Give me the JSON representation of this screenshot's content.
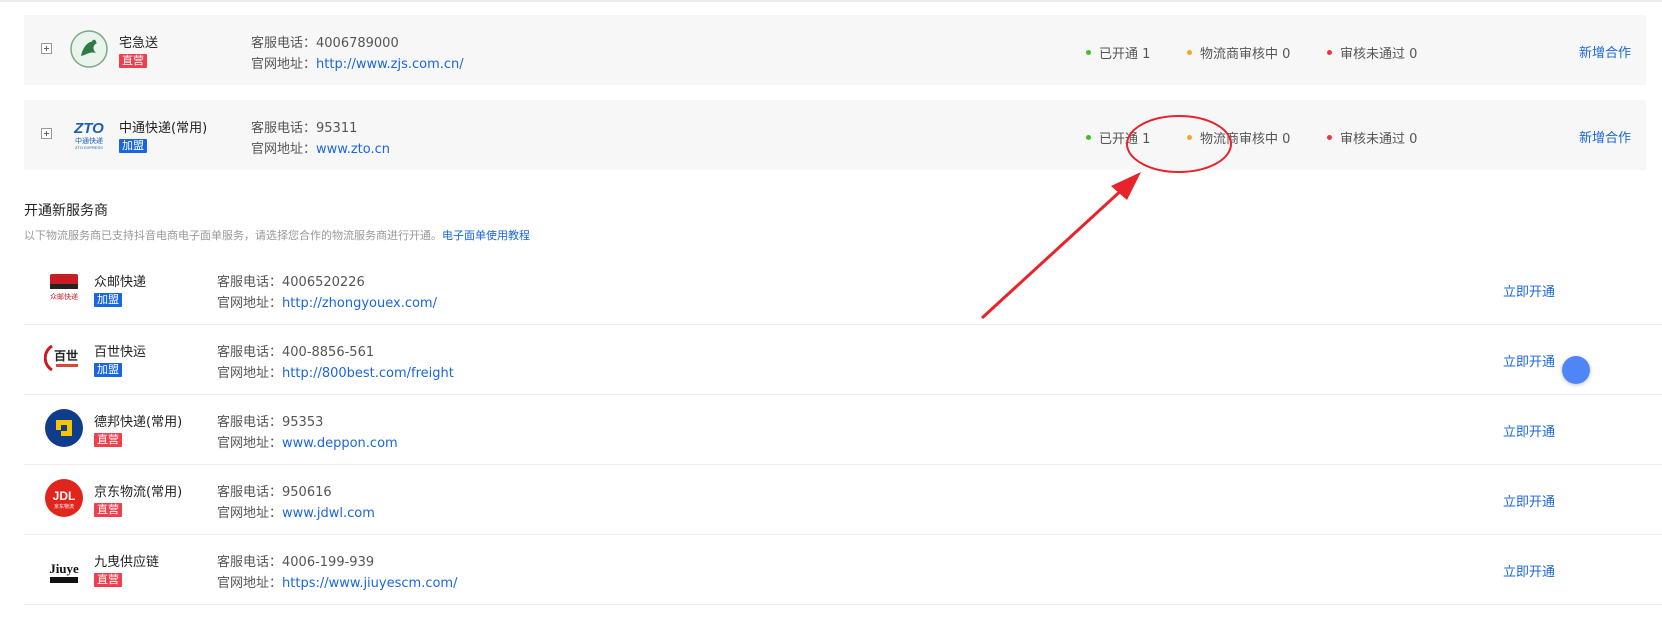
{
  "labels": {
    "phone_prefix": "客服电话：",
    "site_prefix": "官网地址："
  },
  "cooperating": [
    {
      "name": "宅急送",
      "tag": "直营",
      "phone": "4006789000",
      "site": "http://www.zjs.com.cn/",
      "stats": {
        "opened": "已开通 1",
        "reviewing": "物流商审核中 0",
        "rejected": "审核未通过 0"
      },
      "action": "新增合作"
    },
    {
      "name": "中通快递(常用)",
      "tag": "加盟",
      "logo_text": "ZTO",
      "logo_sub": "中通快递",
      "logo_sub2": "ZTO EXPRESS",
      "phone": "95311",
      "site": "www.zto.cn",
      "stats": {
        "opened": "已开通 1",
        "reviewing": "物流商审核中 0",
        "rejected": "审核未通过 0"
      },
      "action": "新增合作"
    }
  ],
  "section": {
    "title": "开通新服务商",
    "desc": "以下物流服务商已支持抖音电商电子面单服务，请选择您合作的物流服务商进行开通。",
    "tutorial_link": "电子面单使用教程"
  },
  "providers": [
    {
      "name": "众邮快递",
      "tag": "加盟",
      "phone": "4006520226",
      "site": "http://zhongyouex.com/",
      "action": "立即开通",
      "logo_text": "众邮快递"
    },
    {
      "name": "百世快运",
      "tag": "加盟",
      "phone": "400-8856-561",
      "site": "http://800best.com/freight",
      "action": "立即开通",
      "logo_text": "百世"
    },
    {
      "name": "德邦快递(常用)",
      "tag": "直营",
      "phone": "95353",
      "site": "www.deppon.com",
      "action": "立即开通"
    },
    {
      "name": "京东物流(常用)",
      "tag": "直营",
      "phone": "950616",
      "site": "www.jdwl.com",
      "action": "立即开通",
      "logo_text": "JDL",
      "logo_sub": "京东物流"
    },
    {
      "name": "九曳供应链",
      "tag": "直营",
      "phone": "4006-199-939",
      "site": "https://www.jiuyescm.com/",
      "action": "立即开通",
      "logo_text": "Jiuye"
    }
  ],
  "colors": {
    "link": "#1a66e0",
    "direct_tag": "#ee3f4d",
    "franchise_tag": "#1a66e0",
    "dot_green": "#3cc51f",
    "dot_orange": "#f5a623",
    "dot_red": "#f0353d",
    "annotation": "#e8232a"
  }
}
